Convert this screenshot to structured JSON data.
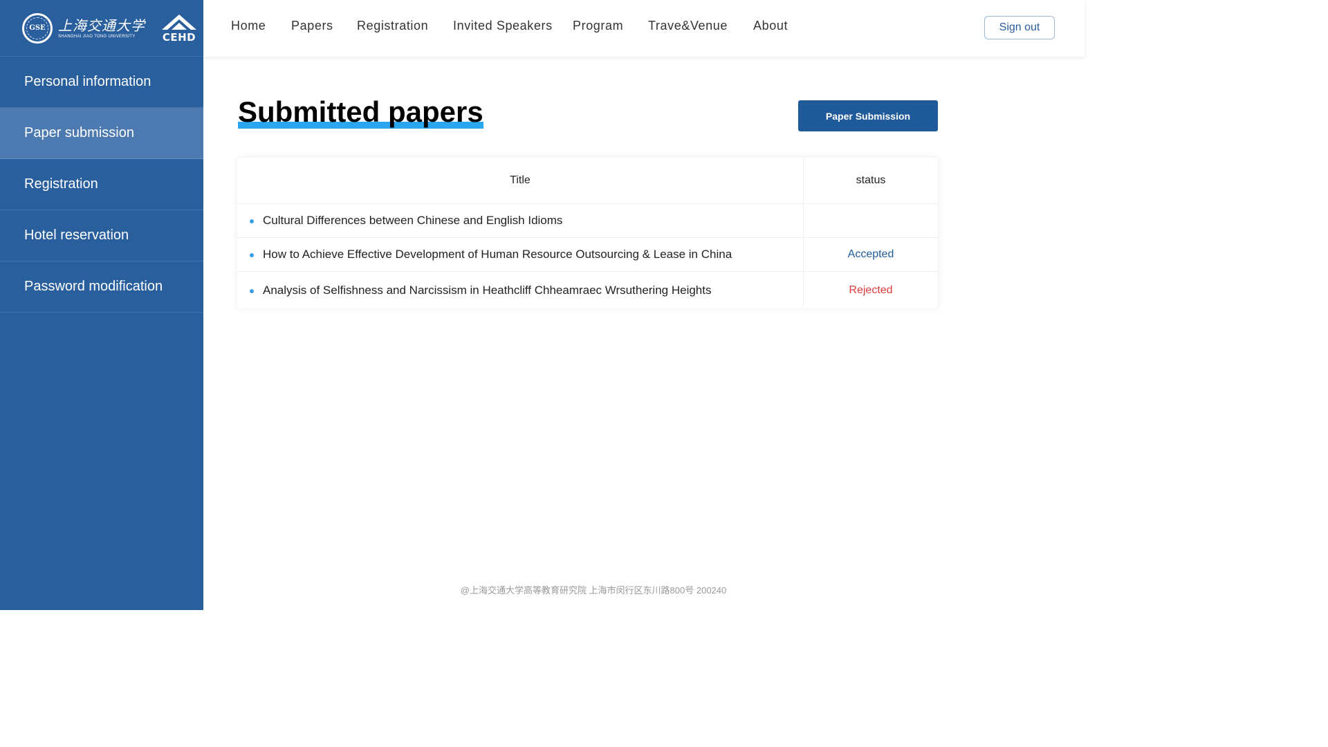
{
  "brand": {
    "seal_text": "GSE",
    "university_cn": "上海交通大学",
    "university_en": "SHANGHAI JIAO TONG UNIVERSITY",
    "cehd_text": "CEHD"
  },
  "sidebar": {
    "items": [
      {
        "label": "Personal information",
        "active": false
      },
      {
        "label": "Paper submission",
        "active": true
      },
      {
        "label": "Registration",
        "active": false
      },
      {
        "label": "Hotel reservation",
        "active": false
      },
      {
        "label": "Password modification",
        "active": false
      }
    ]
  },
  "nav": {
    "items": [
      "Home",
      "Papers",
      "Registration",
      "Invited Speakers",
      "Program",
      "Trave&Venue",
      "About"
    ],
    "sign_out": "Sign out"
  },
  "main": {
    "title": "Submitted papers",
    "submit_button": "Paper Submission",
    "table": {
      "headers": {
        "title": "Title",
        "status": "status"
      },
      "rows": [
        {
          "title": "Cultural Differences between Chinese and English Idioms",
          "status": "",
          "status_color": "#1f5a9a"
        },
        {
          "title": "How to Achieve Effective Development of Human Resource Outsourcing & Lease in China",
          "status": "Accepted",
          "status_color": "#1f5a9a"
        },
        {
          "title": "Analysis of Selfishness and Narcissism in Heathcliff  Chheamraec  Wrsuthering Heights",
          "status": "Rejected",
          "status_color": "#e03a3a"
        }
      ]
    }
  },
  "footer": {
    "text": "@上海交通大学高等教育研究院   上海市闵行区东川路800号   200240"
  },
  "colors": {
    "sidebar_bg": "#2a5f9e",
    "sidebar_active": "#4c7ab0",
    "primary_button": "#1f5a9a",
    "title_highlight": "#2aa7ee",
    "accepted": "#1f5a9a",
    "rejected": "#e03a3a"
  }
}
